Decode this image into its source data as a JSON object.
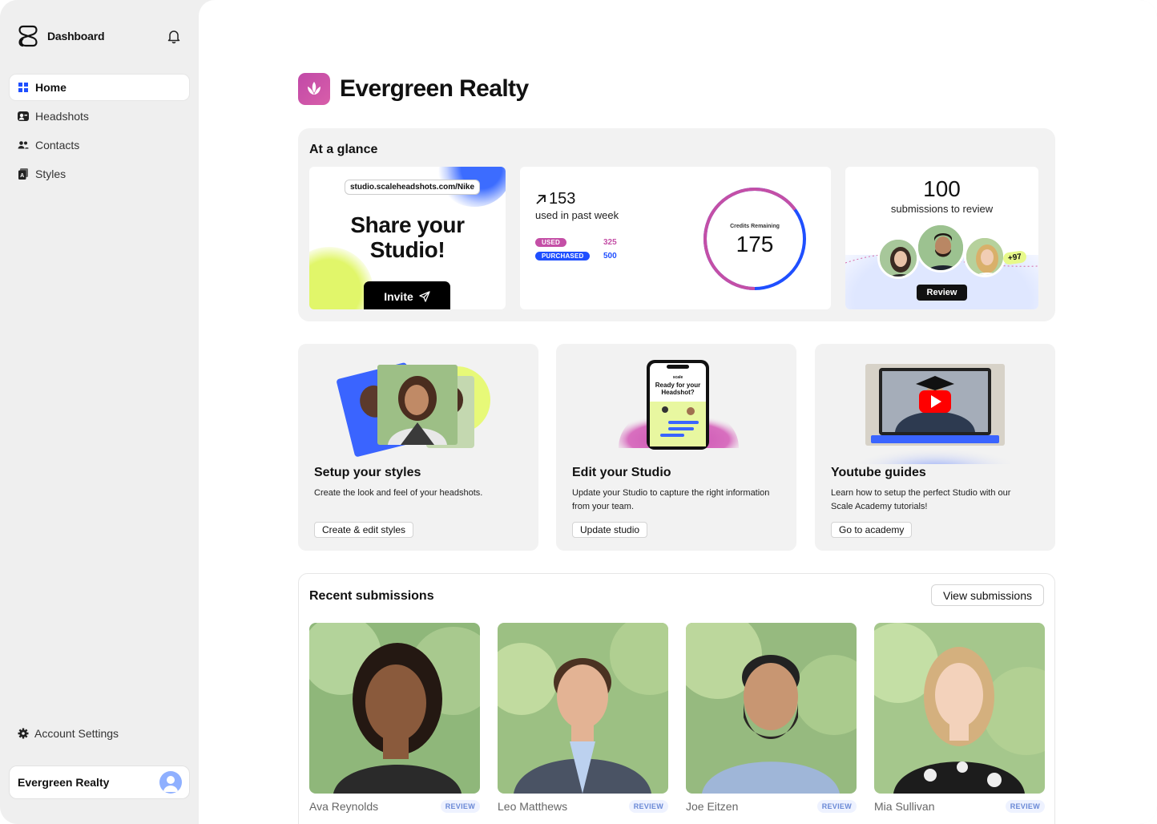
{
  "sidebar": {
    "brand_title": "Dashboard",
    "nav": [
      {
        "label": "Home",
        "icon": "grid-icon"
      },
      {
        "label": "Headshots",
        "icon": "headshot-icon"
      },
      {
        "label": "Contacts",
        "icon": "users-icon"
      },
      {
        "label": "Styles",
        "icon": "style-icon"
      }
    ],
    "account_settings": "Account Settings",
    "org_name": "Evergreen Realty"
  },
  "header": {
    "title": "Evergreen Realty"
  },
  "glance": {
    "title": "At a glance",
    "share": {
      "url": "studio.scaleheadshots.com/Nike",
      "title_line1": "Share your",
      "title_line2": "Studio!",
      "button": "Invite"
    },
    "credits": {
      "used_count": "153",
      "used_caption": "used in past week",
      "used_label": "USED",
      "used_value": "325",
      "purchased_label": "PURCHASED",
      "purchased_value": "500",
      "ring_label": "Credits Remaining",
      "ring_value": "175",
      "used_fraction": 0.65
    },
    "review": {
      "count": "100",
      "caption": "submissions to review",
      "extra": "+97",
      "button": "Review"
    }
  },
  "features": [
    {
      "title": "Setup your styles",
      "desc": "Create the look and feel of your headshots.",
      "button": "Create & edit styles"
    },
    {
      "title": "Edit your Studio",
      "desc": "Update your Studio to capture the right information from your team.",
      "button": "Update studio",
      "phone_text": "Ready for your Headshot?",
      "phone_brand": "scale"
    },
    {
      "title": "Youtube guides",
      "desc": "Learn how to setup the perfect Studio with our Scale Academy tutorials!",
      "button": "Go to academy"
    }
  ],
  "recent": {
    "title": "Recent submissions",
    "view_button": "View submissions",
    "items": [
      {
        "name": "Ava Reynolds",
        "badge": "REVIEW"
      },
      {
        "name": "Leo Matthews",
        "badge": "REVIEW"
      },
      {
        "name": "Joe Eitzen",
        "badge": "REVIEW"
      },
      {
        "name": "Mia Sullivan",
        "badge": "REVIEW"
      }
    ]
  },
  "colors": {
    "accent_blue": "#1f4fff",
    "accent_pink": "#c44fa6",
    "lime": "#e1f66a"
  }
}
